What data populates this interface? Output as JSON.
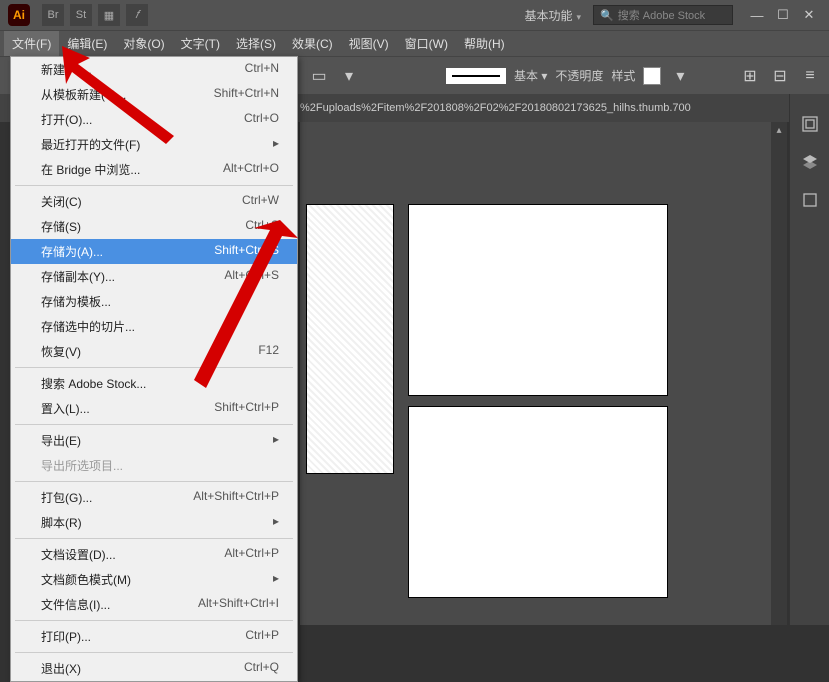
{
  "titlebar": {
    "logo": "Ai",
    "icons": [
      "Br",
      "St"
    ],
    "workspace": "基本功能",
    "search_placeholder": "搜索 Adobe Stock"
  },
  "menubar": {
    "items": [
      "文件(F)",
      "编辑(E)",
      "对象(O)",
      "文字(T)",
      "选择(S)",
      "效果(C)",
      "视图(V)",
      "窗口(W)",
      "帮助(H)"
    ]
  },
  "toolbar": {
    "stroke_style": "基本",
    "opacity_label": "不透明度",
    "style_label": "样式"
  },
  "tab": {
    "filename": "%2Fuploads%2Fitem%2F201808%2F02%2F20180802173625_hilhs.thumb.700"
  },
  "file_menu": {
    "items": [
      {
        "label": "新建(N)...",
        "shortcut": "Ctrl+N"
      },
      {
        "label": "从模板新建(T)...",
        "shortcut": "Shift+Ctrl+N"
      },
      {
        "label": "打开(O)...",
        "shortcut": "Ctrl+O"
      },
      {
        "label": "最近打开的文件(F)",
        "shortcut": "",
        "submenu": true
      },
      {
        "label": "在 Bridge 中浏览...",
        "shortcut": "Alt+Ctrl+O"
      },
      {
        "sep": true
      },
      {
        "label": "关闭(C)",
        "shortcut": "Ctrl+W"
      },
      {
        "label": "存储(S)",
        "shortcut": "Ctrl+S"
      },
      {
        "label": "存储为(A)...",
        "shortcut": "Shift+Ctrl+S",
        "highlight": true
      },
      {
        "label": "存储副本(Y)...",
        "shortcut": "Alt+Ctrl+S"
      },
      {
        "label": "存储为模板...",
        "shortcut": ""
      },
      {
        "label": "存储选中的切片...",
        "shortcut": ""
      },
      {
        "label": "恢复(V)",
        "shortcut": "F12"
      },
      {
        "sep": true
      },
      {
        "label": "搜索 Adobe Stock...",
        "shortcut": ""
      },
      {
        "label": "置入(L)...",
        "shortcut": "Shift+Ctrl+P"
      },
      {
        "sep": true
      },
      {
        "label": "导出(E)",
        "shortcut": "",
        "submenu": true
      },
      {
        "label": "导出所选项目...",
        "shortcut": "",
        "disabled": true
      },
      {
        "sep": true
      },
      {
        "label": "打包(G)...",
        "shortcut": "Alt+Shift+Ctrl+P"
      },
      {
        "label": "脚本(R)",
        "shortcut": "",
        "submenu": true
      },
      {
        "sep": true
      },
      {
        "label": "文档设置(D)...",
        "shortcut": "Alt+Ctrl+P"
      },
      {
        "label": "文档颜色模式(M)",
        "shortcut": "",
        "submenu": true
      },
      {
        "label": "文件信息(I)...",
        "shortcut": "Alt+Shift+Ctrl+I"
      },
      {
        "sep": true
      },
      {
        "label": "打印(P)...",
        "shortcut": "Ctrl+P"
      },
      {
        "sep": true
      },
      {
        "label": "退出(X)",
        "shortcut": "Ctrl+Q"
      }
    ]
  }
}
